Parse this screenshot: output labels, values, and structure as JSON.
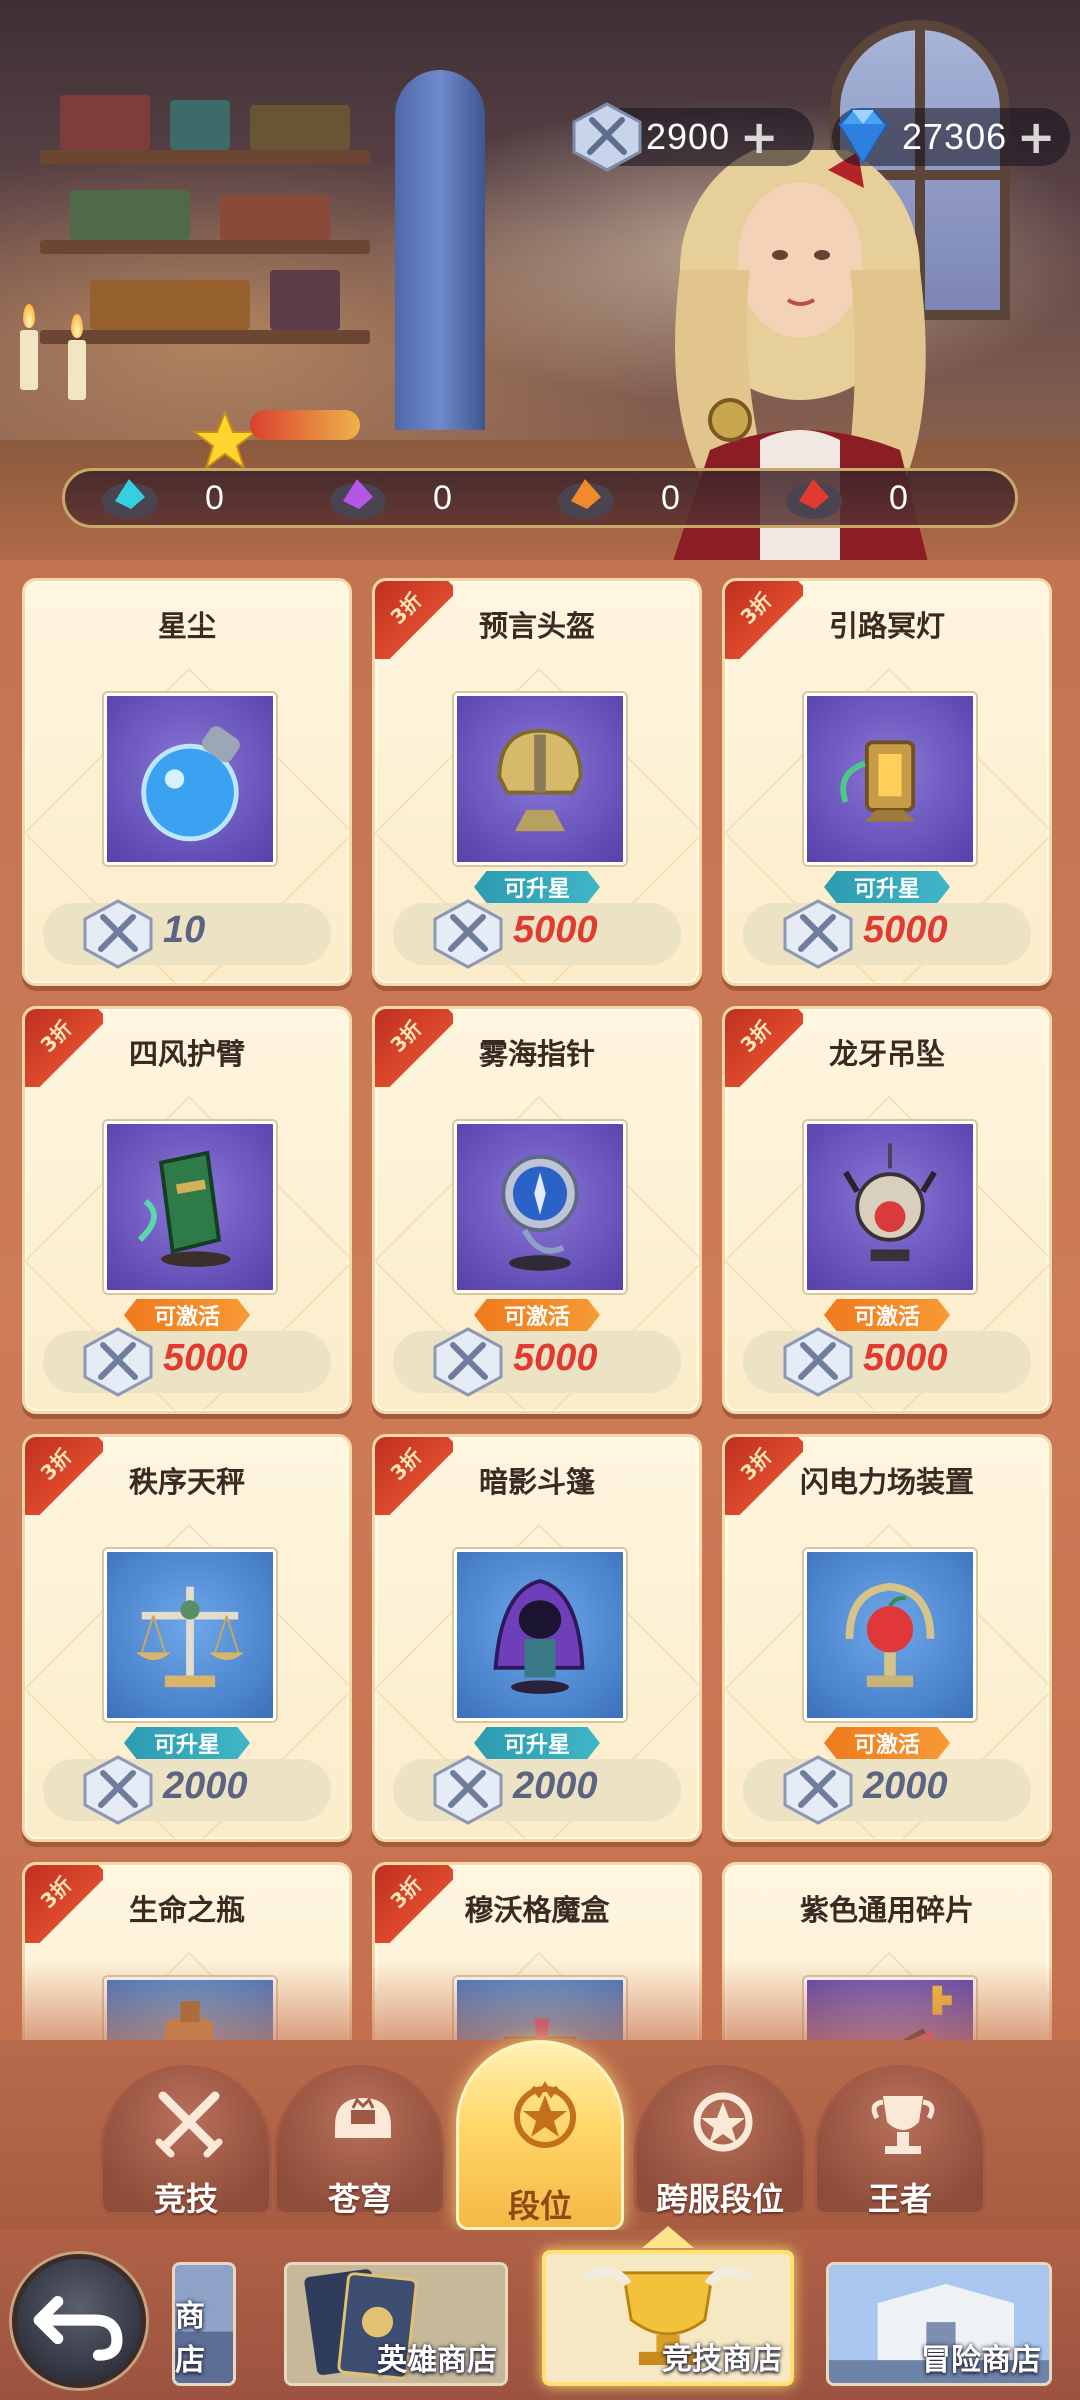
{
  "currencies": [
    {
      "icon": "arena-coin-icon",
      "value": "2900"
    },
    {
      "icon": "diamond-icon",
      "value": "27306"
    }
  ],
  "resources": [
    {
      "icon": "cyan-ore-icon",
      "count": "0"
    },
    {
      "icon": "purple-ore-icon",
      "count": "0"
    },
    {
      "icon": "orange-ore-icon",
      "count": "0"
    },
    {
      "icon": "red-ore-icon",
      "count": "0"
    }
  ],
  "items": [
    {
      "name": "星尘",
      "discount": "",
      "tag": "",
      "tag_type": "",
      "price": "10",
      "price_color": "gray",
      "frame": "purple",
      "icon": "potion-flask-icon"
    },
    {
      "name": "预言头盔",
      "discount": "3折",
      "tag": "可升星",
      "tag_type": "star",
      "price": "5000",
      "price_color": "red",
      "frame": "purple",
      "icon": "helmet-icon"
    },
    {
      "name": "引路冥灯",
      "discount": "3折",
      "tag": "可升星",
      "tag_type": "star",
      "price": "5000",
      "price_color": "red",
      "frame": "purple",
      "icon": "lantern-icon"
    },
    {
      "name": "四风护臂",
      "discount": "3折",
      "tag": "可激活",
      "tag_type": "act",
      "price": "5000",
      "price_color": "red",
      "frame": "purple",
      "icon": "bracer-icon"
    },
    {
      "name": "雾海指针",
      "discount": "3折",
      "tag": "可激活",
      "tag_type": "act",
      "price": "5000",
      "price_color": "red",
      "frame": "purple",
      "icon": "compass-icon"
    },
    {
      "name": "龙牙吊坠",
      "discount": "3折",
      "tag": "可激活",
      "tag_type": "act",
      "price": "5000",
      "price_color": "red",
      "frame": "purple",
      "icon": "pendant-icon"
    },
    {
      "name": "秩序天秤",
      "discount": "3折",
      "tag": "可升星",
      "tag_type": "star",
      "price": "2000",
      "price_color": "gray",
      "frame": "blue",
      "icon": "scales-icon"
    },
    {
      "name": "暗影斗篷",
      "discount": "3折",
      "tag": "可升星",
      "tag_type": "star",
      "price": "2000",
      "price_color": "gray",
      "frame": "blue",
      "icon": "cloak-icon"
    },
    {
      "name": "闪电力场装置",
      "discount": "3折",
      "tag": "可激活",
      "tag_type": "act",
      "price": "2000",
      "price_color": "gray",
      "frame": "blue",
      "icon": "globe-device-icon"
    },
    {
      "name": "生命之瓶",
      "discount": "3折",
      "tag": "",
      "tag_type": "",
      "price": "",
      "price_color": "",
      "frame": "blue",
      "icon": "life-bottle-icon"
    },
    {
      "name": "穆沃格魔盒",
      "discount": "3折",
      "tag": "",
      "tag_type": "",
      "price": "",
      "price_color": "",
      "frame": "blue",
      "icon": "magic-box-icon"
    },
    {
      "name": "紫色通用碎片",
      "discount": "",
      "tag": "",
      "tag_type": "",
      "price": "",
      "price_color": "",
      "frame": "purple",
      "icon": "purple-shard-icon"
    }
  ],
  "nav_tabs": [
    {
      "label": "竞技",
      "icon": "crossed-swords-icon",
      "active": false
    },
    {
      "label": "苍穹",
      "icon": "helmet-crown-icon",
      "active": false
    },
    {
      "label": "段位",
      "icon": "rank-emblem-icon",
      "active": true
    },
    {
      "label": "跨服段位",
      "icon": "cross-server-rank-icon",
      "active": false
    },
    {
      "label": "王者",
      "icon": "king-trophy-icon",
      "active": false
    }
  ],
  "shops": [
    {
      "label": "商店",
      "active": false
    },
    {
      "label": "英雄商店",
      "active": false
    },
    {
      "label": "竞技商店",
      "active": true
    },
    {
      "label": "冒险商店",
      "active": false
    }
  ],
  "colors": {
    "accent_gold": "#ffd76a",
    "price_red": "#e33a2f",
    "price_gray": "#5b6482",
    "tag_star": "#2d9bb0",
    "tag_activate": "#ef7a1e",
    "discount_red": "#c8321f",
    "background": "#c9744f"
  }
}
